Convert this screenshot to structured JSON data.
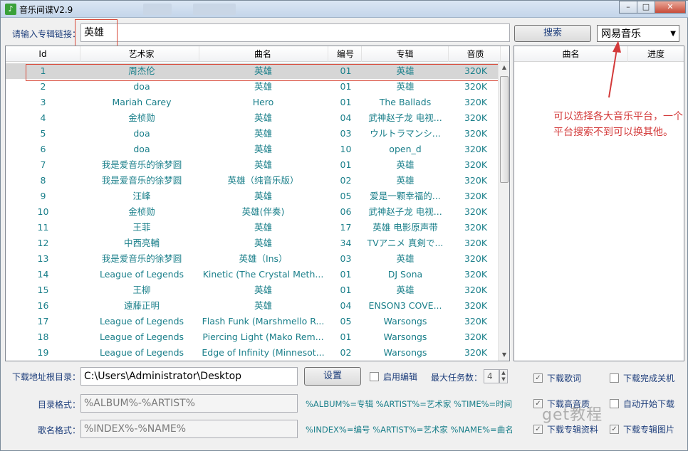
{
  "window": {
    "title": "音乐间谍V2.9"
  },
  "search": {
    "label": "请输入专辑链接：",
    "value": "英雄",
    "button": "搜索",
    "platform": "网易音乐"
  },
  "table": {
    "headers": [
      "Id",
      "艺术家",
      "曲名",
      "编号",
      "专辑",
      "音质"
    ],
    "rows": [
      [
        "1",
        "周杰伦",
        "英雄",
        "01",
        "英雄",
        "320K"
      ],
      [
        "2",
        "doa",
        "英雄",
        "01",
        "英雄",
        "320K"
      ],
      [
        "3",
        "Mariah Carey",
        "Hero",
        "01",
        "The Ballads",
        "320K"
      ],
      [
        "4",
        "金桢勋",
        "英雄",
        "04",
        "武神赵子龙 电视...",
        "320K"
      ],
      [
        "5",
        "doa",
        "英雄",
        "03",
        "ウルトラマンシ...",
        "320K"
      ],
      [
        "6",
        "doa",
        "英雄",
        "10",
        "open_d",
        "320K"
      ],
      [
        "7",
        "我是爱音乐的徐梦圆",
        "英雄",
        "01",
        "英雄",
        "320K"
      ],
      [
        "8",
        "我是爱音乐的徐梦圆",
        "英雄（纯音乐版）",
        "02",
        "英雄",
        "320K"
      ],
      [
        "9",
        "汪峰",
        "英雄",
        "05",
        "爱是一颗幸福的...",
        "320K"
      ],
      [
        "10",
        "金桢勋",
        "英雄(伴奏)",
        "06",
        "武神赵子龙 电视...",
        "320K"
      ],
      [
        "11",
        "王菲",
        "英雄",
        "17",
        "英雄 电影原声带",
        "320K"
      ],
      [
        "12",
        "中西亮輔",
        "英雄",
        "34",
        "TVアニメ 真剣で...",
        "320K"
      ],
      [
        "13",
        "我是爱音乐的徐梦圆",
        "英雄（Ins）",
        "03",
        "英雄",
        "320K"
      ],
      [
        "14",
        "League of Legends",
        "Kinetic (The Crystal Meth...",
        "01",
        "DJ Sona",
        "320K"
      ],
      [
        "15",
        "王柳",
        "英雄",
        "01",
        "英雄",
        "320K"
      ],
      [
        "16",
        "遠藤正明",
        "英雄",
        "04",
        "ENSON3 COVE...",
        "320K"
      ],
      [
        "17",
        "League of Legends",
        "Flash Funk (Marshmello R...",
        "05",
        "Warsongs",
        "320K"
      ],
      [
        "18",
        "League of Legends",
        "Piercing Light (Mako Rem...",
        "01",
        "Warsongs",
        "320K"
      ],
      [
        "19",
        "League of Legends",
        "Edge of Infinity (Minnesot...",
        "02",
        "Warsongs",
        "320K"
      ]
    ]
  },
  "right_panel": {
    "headers": [
      "曲名",
      "进度"
    ]
  },
  "annotation": "可以选择各大音乐平台，一个平台搜索不到可以换其他。",
  "bottom": {
    "download_dir_label": "下载地址根目录：",
    "download_dir_value": "C:\\Users\\Administrator\\Desktop",
    "settings_button": "设置",
    "enable_edit": "启用编辑",
    "max_tasks_label": "最大任务数：",
    "max_tasks_value": "4",
    "dir_format_label": "目录格式：",
    "dir_format_value": "%ALBUM%-%ARTIST%",
    "dir_format_hint": "%ALBUM%=专辑 %ARTIST%=艺术家 %TIME%=时间",
    "name_format_label": "歌名格式：",
    "name_format_value": "%INDEX%-%NAME%",
    "name_format_hint": "%INDEX%=编号 %ARTIST%=艺术家 %NAME%=曲名",
    "options": {
      "lyrics": "下载歌词",
      "shutdown": "下载完成关机",
      "hq": "下载高音质",
      "autostart": "自动开始下载",
      "album_info": "下载专辑资料",
      "album_art": "下载专辑图片"
    },
    "watermark": "get教程"
  }
}
